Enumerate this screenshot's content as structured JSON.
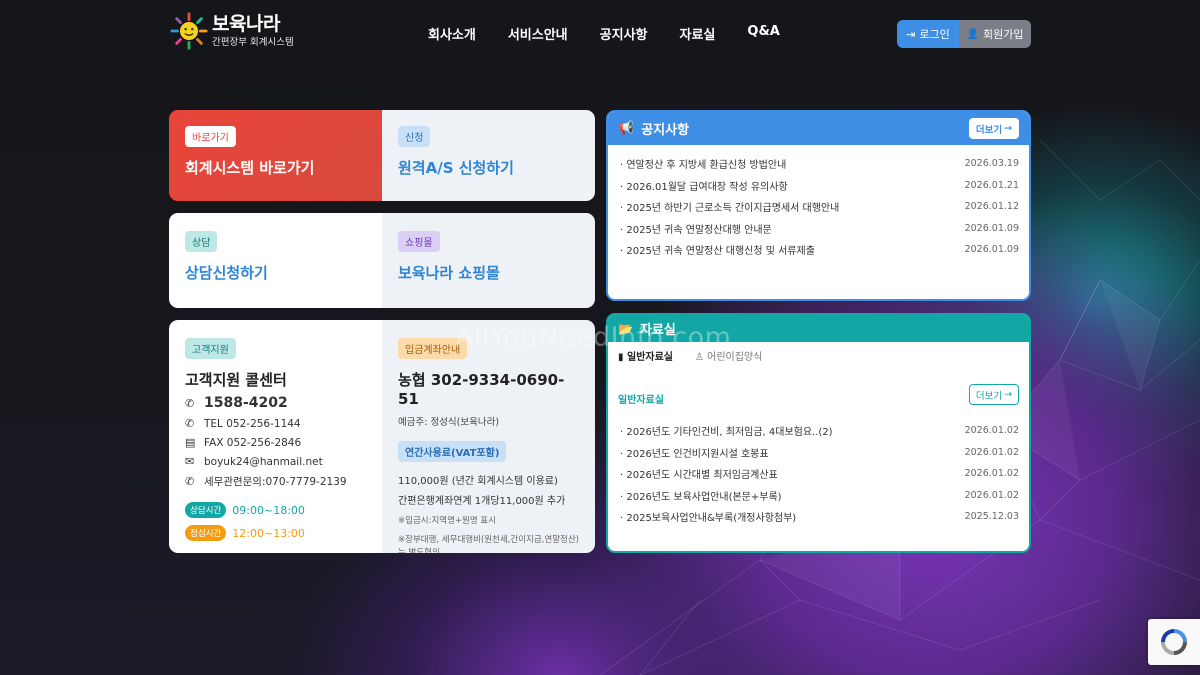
{
  "brand": {
    "title": "보육나라",
    "subtitle": "간편장부 회계시스템"
  },
  "nav": [
    "회사소개",
    "서비스안내",
    "공지사항",
    "자료실",
    "Q&A"
  ],
  "auth": {
    "login": "로그인",
    "join": "회원가입"
  },
  "quick": {
    "shortcut": {
      "badge": "바로가기",
      "title": "회계시스템 바로가기"
    },
    "request": {
      "badge": "신청",
      "title": "원격A/S 신청하기"
    },
    "consult": {
      "badge": "상담",
      "title": "상담신청하기"
    },
    "shop": {
      "badge": "쇼핑몰",
      "title": "보육나라 쇼핑몰"
    }
  },
  "support": {
    "badge": "고객지원",
    "title": "고객지원 콜센터",
    "phone": "1588-4202",
    "tel": "TEL 052-256-1144",
    "fax": "FAX 052-256-2846",
    "email": "boyuk24@hanmail.net",
    "tax": "세무관련문의:070-7779-2139",
    "hours": [
      {
        "label": "상담시간",
        "time": "09:00~18:00"
      },
      {
        "label": "점심시간",
        "time": "12:00~13:00"
      }
    ]
  },
  "deposit": {
    "badge": "입금계좌안내",
    "account": "농협 302-9334-0690-51",
    "holder": "예금주: 정성식(보육나라)",
    "fee_badge": "연간사용료(VAT포함)",
    "fee_line1": "110,000원 (년간 회계시스템 이용료)",
    "fee_line2": "간편은행계좌연계 1개당11,000원 추가",
    "note1": "※입금시:지역명+원명 표시",
    "note2": "※장부대행, 세무대행비(원천세,간이지급,연말정산)는 별도협의"
  },
  "notice": {
    "title": "공지사항",
    "more": "더보기",
    "items": [
      {
        "text": "· 연말정산 후 지방세 환급신청 방법안내",
        "date": "2026.03.19"
      },
      {
        "text": "· 2026.01월달 급여대장 작성 유의사항",
        "date": "2026.01.21"
      },
      {
        "text": "· 2025년 하반기 근로소득 간이지급명세서 대행안내",
        "date": "2026.01.12"
      },
      {
        "text": "· 2025년 귀속 연말정산대행 안내문",
        "date": "2026.01.09"
      },
      {
        "text": "· 2025년 귀속 연말정산 대행신청 및 서류제출",
        "date": "2026.01.09"
      }
    ]
  },
  "archive": {
    "title": "자료실",
    "tab1": "일반자료실",
    "tab2": "어린이집양식",
    "section": "일반자료실",
    "more": "더보기",
    "items": [
      {
        "text": "· 2026년도 기타인건비, 최저임금, 4대보험요..(2)",
        "date": "2026.01.02"
      },
      {
        "text": "· 2026년도 인건비지원시설 호봉표",
        "date": "2026.01.02"
      },
      {
        "text": "· 2026년도 시간대별 최저임금계산표",
        "date": "2026.01.02"
      },
      {
        "text": "· 2026년도 보육사업안내(본문+부록)",
        "date": "2026.01.02"
      },
      {
        "text": "· 2025보육사업안내&부록(개정사항첨부)",
        "date": "2025.12.03"
      }
    ]
  },
  "watermark": "AllYouNeedInfo.com",
  "colors": {
    "blue": "#3f8ee6",
    "teal": "#12a7a5",
    "red": "#e8453a"
  }
}
